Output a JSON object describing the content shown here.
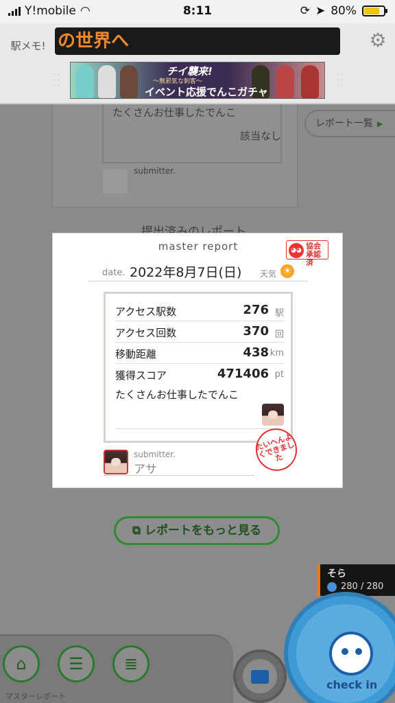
{
  "status_bar": {
    "carrier": "Y!mobile",
    "time": "8:11",
    "battery": "80%",
    "battery_level": 0.8
  },
  "header": {
    "logo_text": "駅メモ!",
    "ticker_text": "の世界へ",
    "banner": {
      "title": "チイ襲来!",
      "subtitle": "～無邪気な刺客～",
      "caption": "イベント応援でんこガチャ"
    }
  },
  "background": {
    "comment": "たくさんお仕事したでんこ",
    "none_text": "該当なし",
    "submitter_label": "submitter.",
    "submitted_heading": "提出済みのレポート",
    "report_list_label": "レポート一覧"
  },
  "modal": {
    "title": "master report",
    "badge_line1": "協会",
    "badge_line2": "承認済",
    "date_label": "date.",
    "date_value": "2022年8月7日(日)",
    "weather_label": "天気",
    "stats": [
      {
        "label": "アクセス駅数",
        "value": "276",
        "unit": "駅"
      },
      {
        "label": "アクセス回数",
        "value": "370",
        "unit": "回"
      },
      {
        "label": "移動距離",
        "value": "438",
        "unit": "km"
      },
      {
        "label": "獲得スコア",
        "value": "471406",
        "unit": "pt"
      }
    ],
    "comment": "たくさんお仕事したでんこ",
    "submitter_label": "submitter.",
    "submitter_name": "アサ",
    "stamp_text": "たいへんよくできました"
  },
  "more_button_label": "レポートをもっと見る",
  "partner": {
    "name": "そら",
    "hp": "280 / 280"
  },
  "nav": {
    "caption": "マスターレポート",
    "checkin_label": "check in"
  },
  "colors": {
    "accent_green": "#2e8b2e",
    "checkin_blue": "#3f9ad6",
    "ticker_orange": "#f28a2c",
    "stamp_red": "#e03030"
  }
}
